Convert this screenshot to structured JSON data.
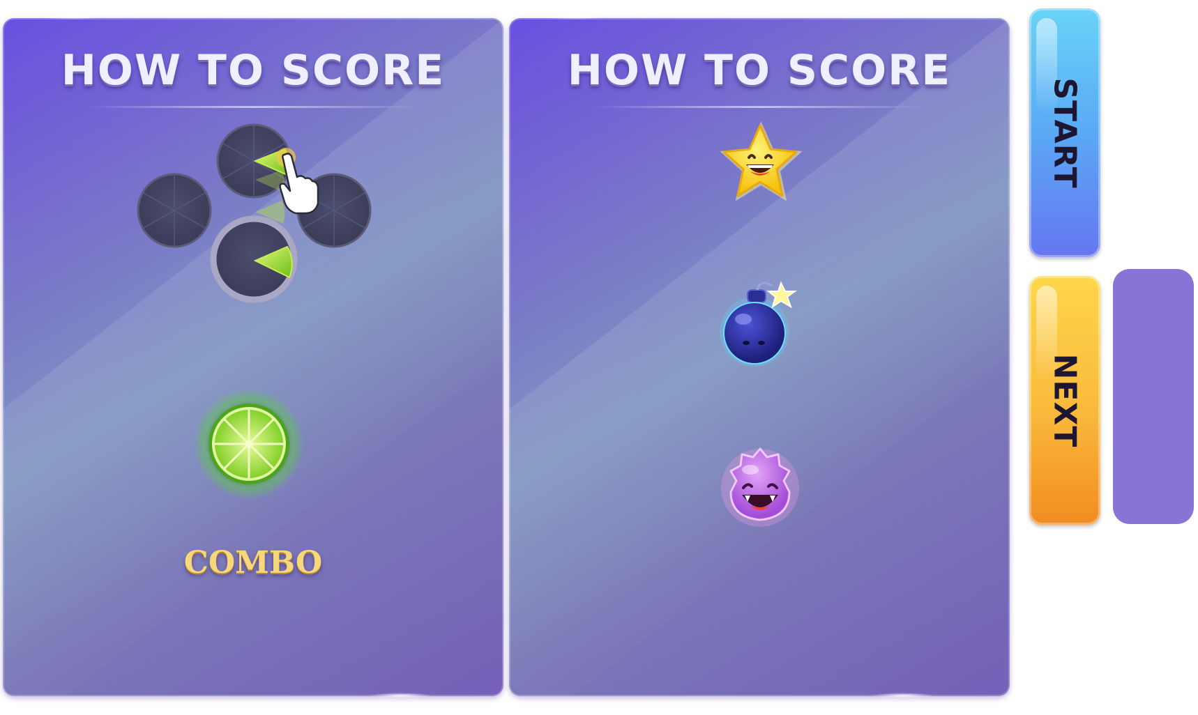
{
  "panels": [
    {
      "title": "HOW TO SCORE",
      "combo_label": "COMBO"
    },
    {
      "title": "HOW TO SCORE"
    }
  ],
  "buttons": {
    "start_label": "START",
    "next_label": "NEXT"
  },
  "icons": {
    "tap_pads": "tap-pad-icon",
    "hand": "pointing-hand-icon",
    "lime": "lime-slice-icon",
    "star": "smiling-star-icon",
    "bomb": "bomb-icon",
    "monster": "purple-monster-icon"
  },
  "colors": {
    "panel": "#6a4fe0",
    "start_button": "#5aa9f5",
    "next_button": "#f9b93b",
    "placeholder": "#8a73d6",
    "combo_text": "#f6d77a"
  }
}
